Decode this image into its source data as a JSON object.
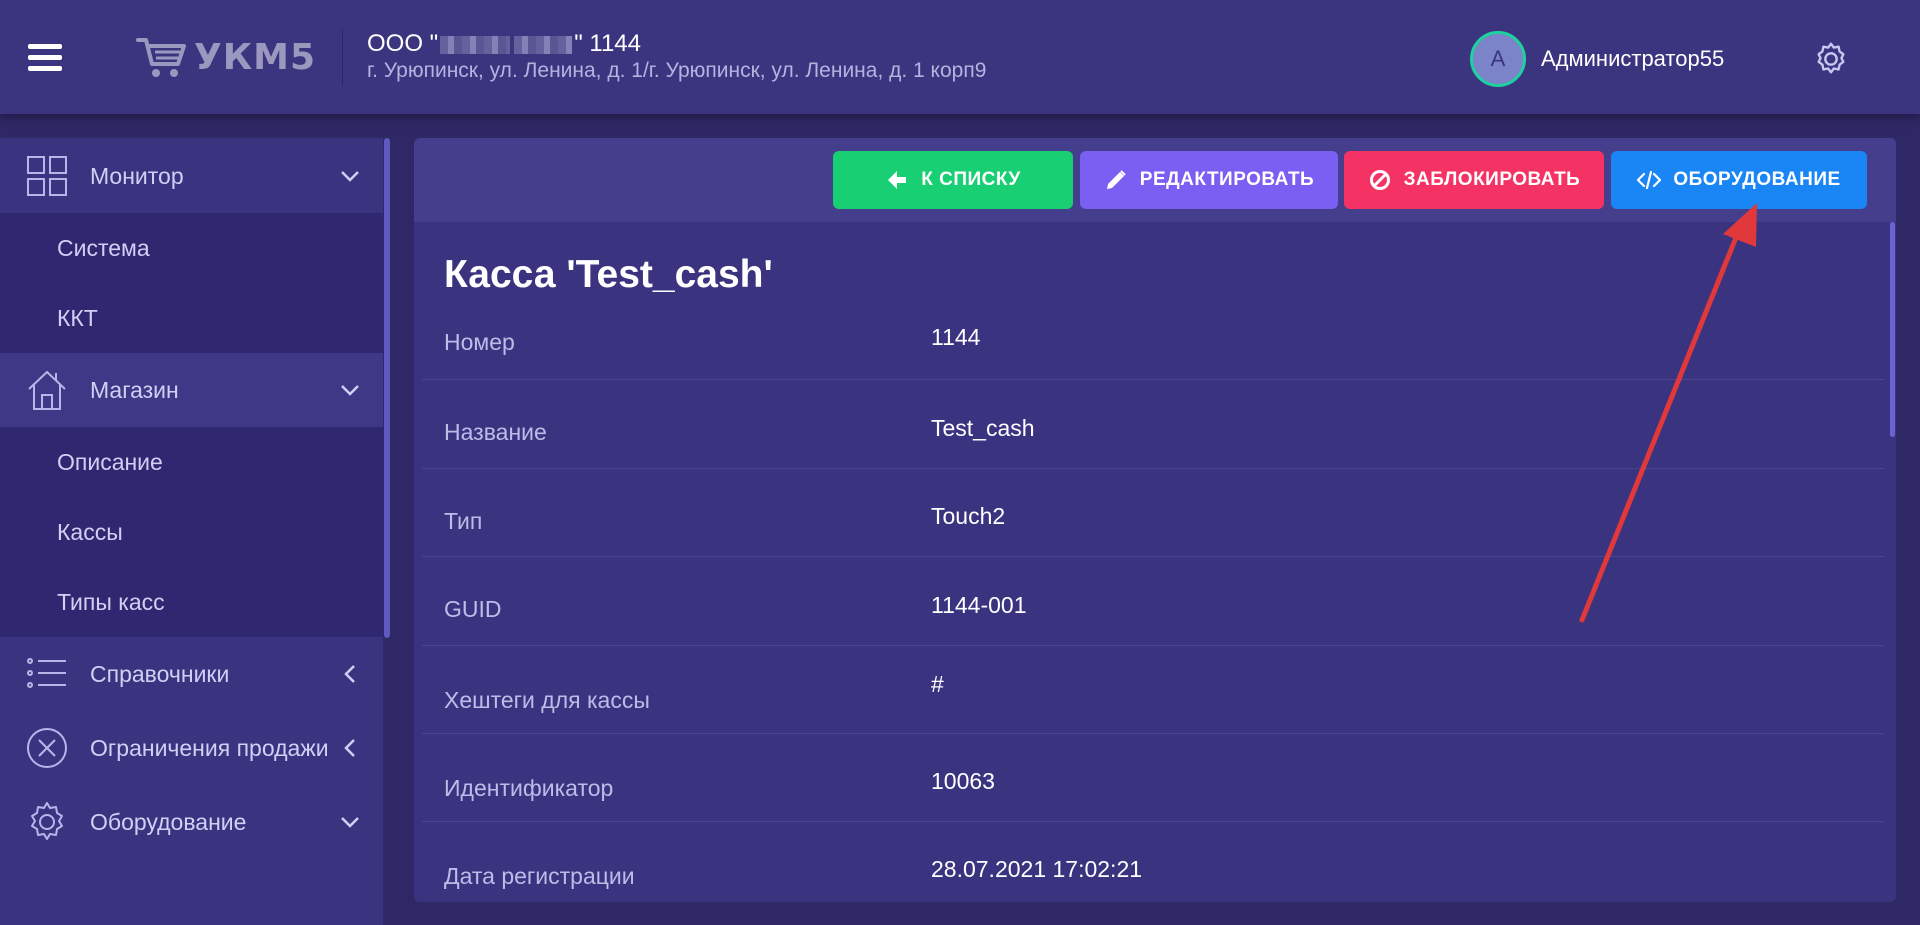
{
  "header": {
    "logo_text": "УКМ5",
    "org_prefix": "ООО \"",
    "org_suffix": "\" 1144",
    "org_address": "г. Урюпинск, ул. Ленина, д. 1/г. Урюпинск, ул. Ленина, д. 1 корп9",
    "avatar_letter": "A",
    "username": "Администратор55"
  },
  "sidebar": {
    "groups": [
      {
        "label": "Монитор",
        "icon": "grid-icon",
        "chevron": "chevron-down-icon",
        "items": [
          "Система",
          "ККТ"
        ]
      },
      {
        "label": "Магазин",
        "icon": "house-icon",
        "chevron": "chevron-down-icon",
        "items": [
          "Описание",
          "Кассы",
          "Типы касс"
        ]
      },
      {
        "label": "Справочники",
        "icon": "list-icon",
        "chevron": "chevron-left-icon",
        "items": []
      },
      {
        "label": "Ограничения продажи",
        "icon": "circle-x-icon",
        "chevron": "chevron-left-icon",
        "items": []
      },
      {
        "label": "Оборудование",
        "icon": "gear-icon",
        "chevron": "chevron-down-icon",
        "items": []
      }
    ]
  },
  "toolbar": {
    "back_label": "К СПИСКУ",
    "edit_label": "РЕДАКТИРОВАТЬ",
    "block_label": "ЗАБЛОКИРОВАТЬ",
    "equipment_label": "ОБОРУДОВАНИЕ"
  },
  "details": {
    "title": "Касса 'Test_cash'",
    "rows": [
      {
        "label": "Номер",
        "value": "1144"
      },
      {
        "label": "Название",
        "value": "Test_cash"
      },
      {
        "label": "Тип",
        "value": "Touch2"
      },
      {
        "label": "GUID",
        "value": "1144-001"
      },
      {
        "label": "Хештеги для кассы",
        "value": "#"
      },
      {
        "label": "Идентификатор",
        "value": "10063"
      },
      {
        "label": "Дата регистрации",
        "value": "28.07.2021 17:02:21"
      }
    ]
  },
  "colors": {
    "background": "#2e2866",
    "header": "#3b3580",
    "back_button": "#18cf73",
    "edit_button": "#7b5ff3",
    "block_button": "#f43264",
    "equipment_button": "#1a86f5",
    "annotation_arrow": "#e0383b"
  }
}
